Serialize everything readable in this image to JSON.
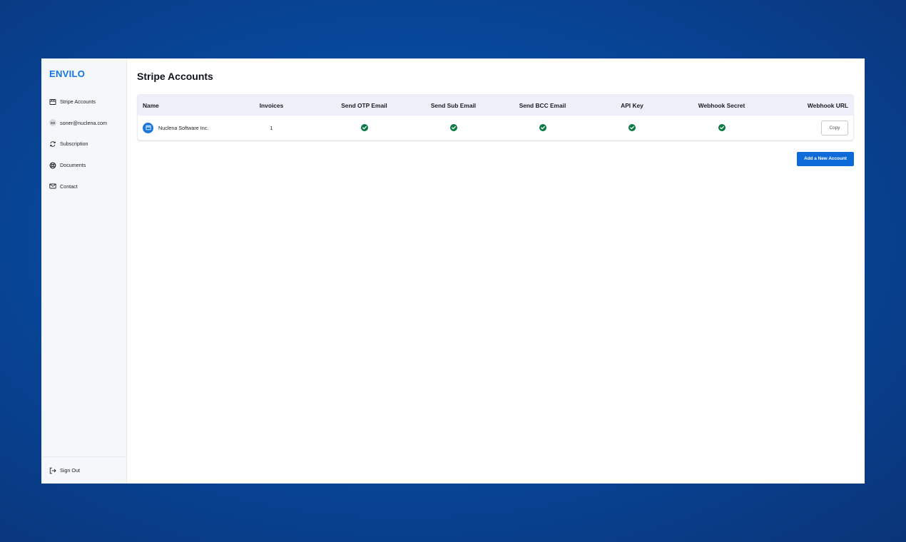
{
  "brand": {
    "name": "ENVILO",
    "color": "#1473e6"
  },
  "sidebar": {
    "items": [
      {
        "label": "Stripe Accounts",
        "icon": "storefront-icon"
      },
      {
        "label": "soner@nuclena.com",
        "icon": "avatar",
        "avatar_initials": "SO"
      },
      {
        "label": "Subscription",
        "icon": "refresh-icon"
      },
      {
        "label": "Documents",
        "icon": "lifebuoy-icon"
      },
      {
        "label": "Contact",
        "icon": "mail-icon"
      }
    ],
    "footer": {
      "label": "Sign Out",
      "icon": "sign-out-icon"
    }
  },
  "main": {
    "title": "Stripe Accounts",
    "table": {
      "headers": [
        "Name",
        "Invoices",
        "Send OTP Email",
        "Send Sub Email",
        "Send BCC Email",
        "API Key",
        "Webhook Secret",
        "Webhook URL"
      ],
      "rows": [
        {
          "name": "Nuclena Software Inc.",
          "invoices": "1",
          "send_otp_email": true,
          "send_sub_email": true,
          "send_bcc_email": true,
          "api_key": true,
          "webhook_secret": true,
          "webhook_url_action": "Copy"
        }
      ]
    },
    "add_button_label": "Add a New Account"
  },
  "colors": {
    "accent": "#0c6ad9",
    "check": "#0b7a45",
    "header_bg": "#efeffa"
  }
}
